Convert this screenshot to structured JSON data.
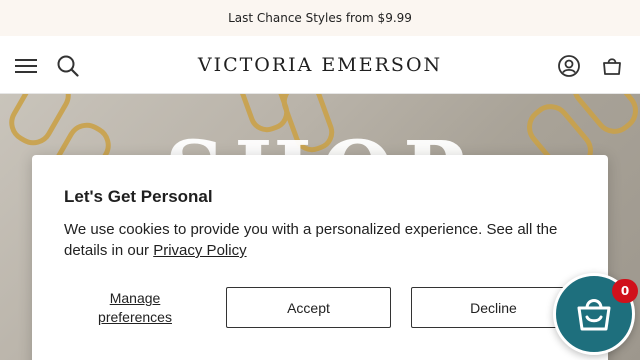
{
  "announcement": {
    "text": "Last Chance Styles from $9.99"
  },
  "header": {
    "brand": "VICTORIA EMERSON",
    "icons": [
      "menu-icon",
      "search-icon",
      "account-icon",
      "cart-icon"
    ]
  },
  "hero": {
    "text": "SHOP"
  },
  "cookie_modal": {
    "title": "Let's Get Personal",
    "body": "We use cookies to provide you with a personalized experience. See all the details in our ",
    "policy_link": "Privacy Policy",
    "manage_label": "Manage preferences",
    "accept_label": "Accept",
    "decline_label": "Decline"
  },
  "cart_widget": {
    "count": "0"
  },
  "colors": {
    "accent": "#1e6f7d",
    "badge": "#d0111b",
    "announce_bg": "#fbf6f1"
  }
}
